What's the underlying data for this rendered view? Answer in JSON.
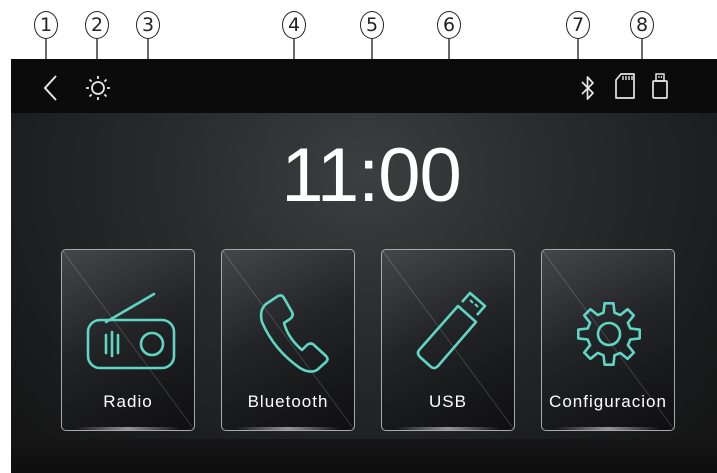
{
  "callouts": [
    "1",
    "2",
    "3",
    "4",
    "5",
    "6",
    "7",
    "8"
  ],
  "topbar": {
    "left_icons": [
      "back-chevron-icon",
      "brightness-icon"
    ],
    "right_icons": [
      "bluetooth-icon",
      "sd-card-icon",
      "usb-drive-icon"
    ]
  },
  "clock": {
    "time": "11:00"
  },
  "tiles": [
    {
      "label": "Radio",
      "icon": "radio-icon"
    },
    {
      "label": "Bluetooth",
      "icon": "phone-icon"
    },
    {
      "label": "USB",
      "icon": "usb-stick-icon"
    },
    {
      "label": "Configuracion",
      "icon": "gear-icon"
    }
  ],
  "colors": {
    "accent": "#5fd6c4",
    "background": "#1f2022",
    "topbar": "#0b0b0b",
    "text": "#ffffff"
  }
}
